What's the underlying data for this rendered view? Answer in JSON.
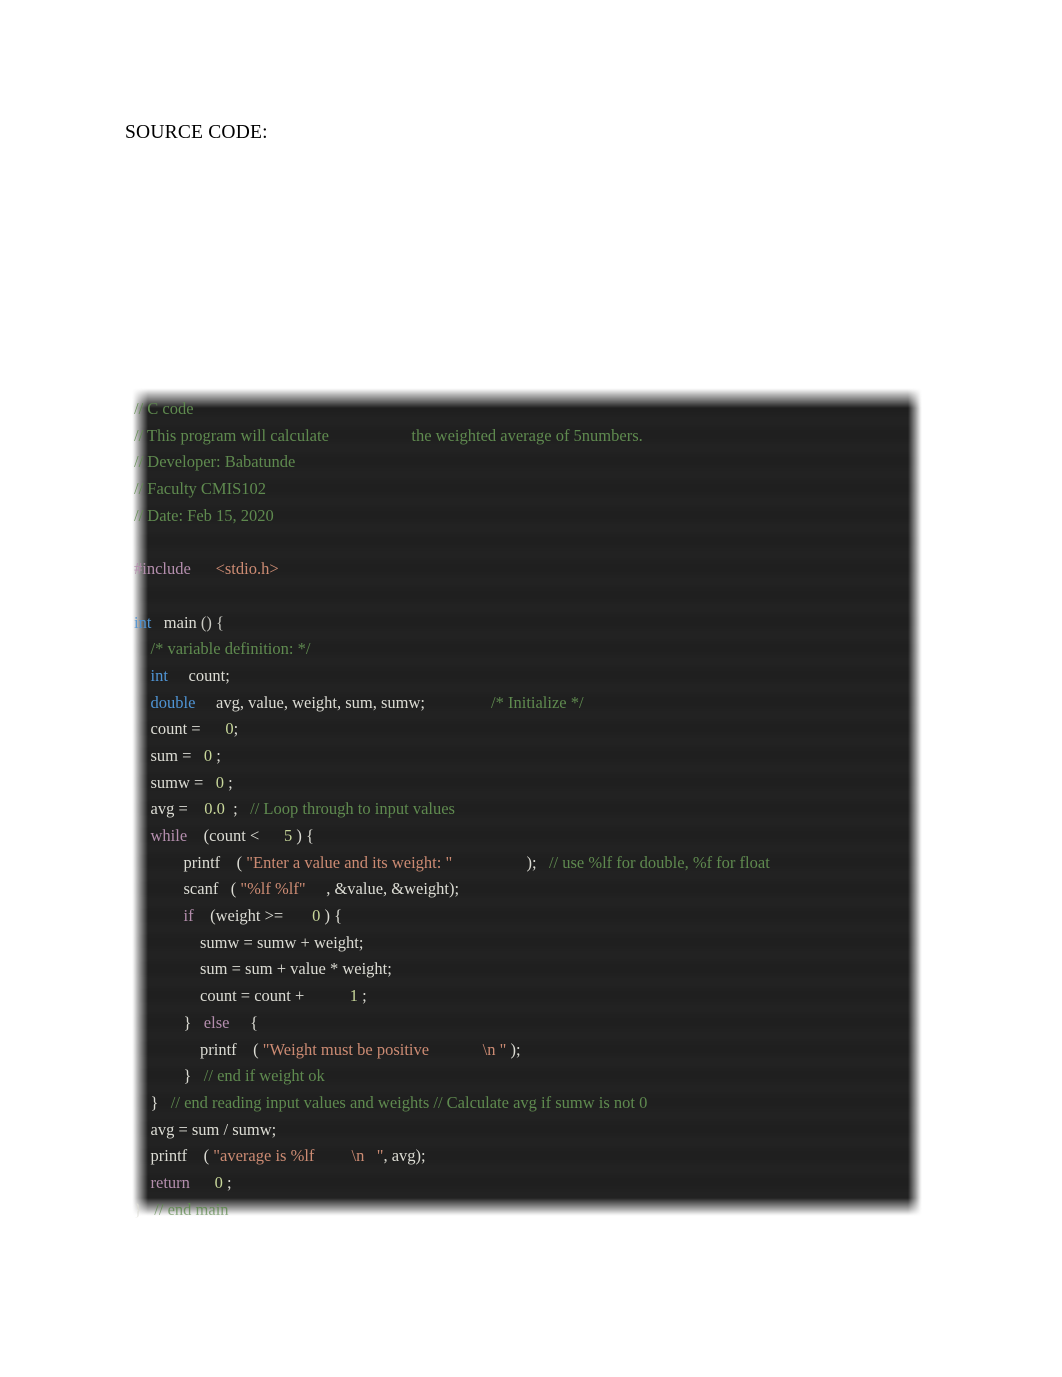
{
  "document": {
    "heading": "SOURCE CODE:"
  },
  "colors": {
    "page_background": "#ffffff",
    "code_background": "#1f1f1f",
    "comment": "#5f8a4f",
    "keyword": "#b48ead",
    "type": "#4f94d4",
    "function": "#d8d8a0",
    "string": "#cc8b73",
    "number": "#c8d79a",
    "plain": "#dcdcd4"
  },
  "code_block": {
    "language": "c",
    "lines": [
      {
        "indent": 0,
        "tokens": [
          {
            "text": "// C code",
            "type": "comment"
          }
        ]
      },
      {
        "indent": 0,
        "tokens": [
          {
            "text": "// This program will calculate                    the weighted average of 5numbers.",
            "type": "comment"
          }
        ]
      },
      {
        "indent": 0,
        "tokens": [
          {
            "text": "// Developer: Babatunde",
            "type": "comment"
          }
        ]
      },
      {
        "indent": 0,
        "tokens": [
          {
            "text": "// Faculty CMIS102",
            "type": "comment"
          }
        ]
      },
      {
        "indent": 0,
        "tokens": [
          {
            "text": "// Date: Feb 15, 2020",
            "type": "comment"
          }
        ]
      },
      {
        "indent": 0,
        "tokens": [
          {
            "text": "",
            "type": "plain"
          }
        ]
      },
      {
        "indent": 0,
        "tokens": [
          {
            "text": "#include",
            "type": "keyword"
          },
          {
            "text": "      ",
            "type": "plain"
          },
          {
            "text": "<stdio.h>",
            "type": "string"
          }
        ]
      },
      {
        "indent": 0,
        "tokens": [
          {
            "text": "",
            "type": "plain"
          }
        ]
      },
      {
        "indent": 0,
        "tokens": [
          {
            "text": "int",
            "type": "type"
          },
          {
            "text": "   ",
            "type": "plain"
          },
          {
            "text": "main",
            "type": "function"
          },
          {
            "text": " () {",
            "type": "punct"
          }
        ]
      },
      {
        "indent": 1,
        "tokens": [
          {
            "text": "/* variable definition: */",
            "type": "comment"
          }
        ]
      },
      {
        "indent": 1,
        "tokens": [
          {
            "text": "int",
            "type": "type"
          },
          {
            "text": "     count;",
            "type": "plain"
          }
        ]
      },
      {
        "indent": 1,
        "tokens": [
          {
            "text": "double",
            "type": "type"
          },
          {
            "text": "     avg, value, weight, sum, sumw;                ",
            "type": "plain"
          },
          {
            "text": "/* Initialize */",
            "type": "comment"
          }
        ]
      },
      {
        "indent": 1,
        "tokens": [
          {
            "text": "count =      ",
            "type": "plain"
          },
          {
            "text": "0",
            "type": "number"
          },
          {
            "text": ";",
            "type": "plain"
          }
        ]
      },
      {
        "indent": 1,
        "tokens": [
          {
            "text": "sum =   ",
            "type": "plain"
          },
          {
            "text": "0",
            "type": "number"
          },
          {
            "text": " ;",
            "type": "plain"
          }
        ]
      },
      {
        "indent": 1,
        "tokens": [
          {
            "text": "sumw =   ",
            "type": "plain"
          },
          {
            "text": "0",
            "type": "number"
          },
          {
            "text": " ;",
            "type": "plain"
          }
        ]
      },
      {
        "indent": 1,
        "tokens": [
          {
            "text": "avg =    ",
            "type": "plain"
          },
          {
            "text": "0.0",
            "type": "number"
          },
          {
            "text": "  ;   ",
            "type": "plain"
          },
          {
            "text": "// Loop through to input values",
            "type": "comment"
          }
        ]
      },
      {
        "indent": 1,
        "tokens": [
          {
            "text": "while",
            "type": "keyword"
          },
          {
            "text": "    (count <      ",
            "type": "plain"
          },
          {
            "text": "5",
            "type": "number"
          },
          {
            "text": " ) {",
            "type": "plain"
          }
        ]
      },
      {
        "indent": 3,
        "tokens": [
          {
            "text": "printf",
            "type": "function"
          },
          {
            "text": "    ( ",
            "type": "plain"
          },
          {
            "text": "\"Enter a value and its weight: \"",
            "type": "string"
          },
          {
            "text": "                  );   ",
            "type": "plain"
          },
          {
            "text": "// use %lf for double, %f for float",
            "type": "comment"
          }
        ]
      },
      {
        "indent": 3,
        "tokens": [
          {
            "text": "scanf",
            "type": "function"
          },
          {
            "text": "   ( ",
            "type": "plain"
          },
          {
            "text": "\"%lf %lf\"",
            "type": "string"
          },
          {
            "text": "     , &value, &weight);",
            "type": "plain"
          }
        ]
      },
      {
        "indent": 3,
        "tokens": [
          {
            "text": "if",
            "type": "keyword"
          },
          {
            "text": "    (weight >=       ",
            "type": "plain"
          },
          {
            "text": "0",
            "type": "number"
          },
          {
            "text": " ) {",
            "type": "plain"
          }
        ]
      },
      {
        "indent": 4,
        "tokens": [
          {
            "text": "sumw = sumw + weight;",
            "type": "plain"
          }
        ]
      },
      {
        "indent": 4,
        "tokens": [
          {
            "text": "sum = sum + value * weight;",
            "type": "plain"
          }
        ]
      },
      {
        "indent": 4,
        "tokens": [
          {
            "text": "count = count +           ",
            "type": "plain"
          },
          {
            "text": "1",
            "type": "number"
          },
          {
            "text": " ;",
            "type": "plain"
          }
        ]
      },
      {
        "indent": 3,
        "tokens": [
          {
            "text": "}   ",
            "type": "plain"
          },
          {
            "text": "else",
            "type": "keyword"
          },
          {
            "text": "     {",
            "type": "plain"
          }
        ]
      },
      {
        "indent": 4,
        "tokens": [
          {
            "text": "printf",
            "type": "function"
          },
          {
            "text": "    ( ",
            "type": "plain"
          },
          {
            "text": "\"Weight must be positive             \\n \"",
            "type": "string"
          },
          {
            "text": " );",
            "type": "plain"
          }
        ]
      },
      {
        "indent": 3,
        "tokens": [
          {
            "text": "}   ",
            "type": "plain"
          },
          {
            "text": "// end if weight ok",
            "type": "comment"
          }
        ]
      },
      {
        "indent": 1,
        "tokens": [
          {
            "text": "}   ",
            "type": "plain"
          },
          {
            "text": "// end reading input values and weights // Calculate avg if sumw is not 0",
            "type": "comment"
          }
        ]
      },
      {
        "indent": 1,
        "tokens": [
          {
            "text": "avg = sum / sumw;",
            "type": "plain"
          }
        ]
      },
      {
        "indent": 1,
        "tokens": [
          {
            "text": "printf",
            "type": "function"
          },
          {
            "text": "    ( ",
            "type": "plain"
          },
          {
            "text": "\"average is %lf         \\n   \"",
            "type": "string"
          },
          {
            "text": ", avg);",
            "type": "plain"
          }
        ]
      },
      {
        "indent": 1,
        "tokens": [
          {
            "text": "return",
            "type": "keyword"
          },
          {
            "text": "      ",
            "type": "plain"
          },
          {
            "text": "0",
            "type": "number"
          },
          {
            "text": " ;",
            "type": "plain"
          }
        ]
      },
      {
        "indent": 0,
        "tokens": [
          {
            "text": "}   ",
            "type": "plain"
          },
          {
            "text": "// end main",
            "type": "comment"
          }
        ]
      }
    ]
  }
}
